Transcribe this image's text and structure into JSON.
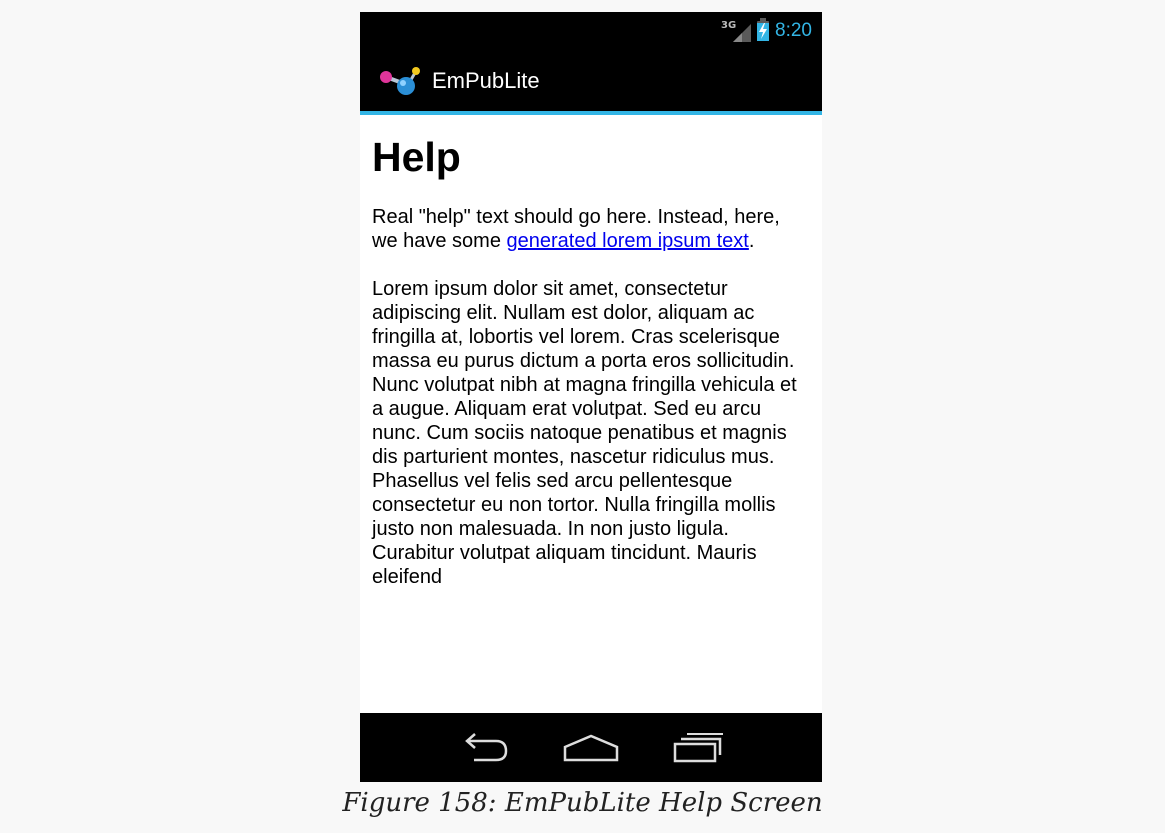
{
  "status_bar": {
    "network_label": "3G",
    "time": "8:20",
    "icons": [
      "signal-icon",
      "battery-charging-icon"
    ]
  },
  "action_bar": {
    "app_icon": "app-logo-icon",
    "title": "EmPubLite"
  },
  "content": {
    "heading": "Help",
    "intro_before_link": "Real \"help\" text should go here. Instead, here, we have some ",
    "intro_link": "generated lorem ipsum text",
    "intro_after_link": ".",
    "body": "Lorem ipsum dolor sit amet, consectetur adipiscing elit. Nullam est dolor, aliquam ac fringilla at, lobortis vel lorem. Cras scelerisque massa eu purus dictum a porta eros sollicitudin. Nunc volutpat nibh at magna fringilla vehicula et a augue. Aliquam erat volutpat. Sed eu arcu nunc. Cum sociis natoque penatibus et magnis dis parturient montes, nascetur ridiculus mus. Phasellus vel felis sed arcu pellentesque consectetur eu non tortor. Nulla fringilla mollis justo non malesuada. In non justo ligula. Curabitur volutpat aliquam tincidunt. Mauris eleifend"
  },
  "nav_bar": {
    "buttons": [
      "back-icon",
      "home-icon",
      "recent-apps-icon"
    ]
  },
  "caption": "Figure 158: EmPubLite Help Screen",
  "colors": {
    "accent": "#33b5e5",
    "bar_background": "#000000",
    "link": "#0000ee"
  }
}
